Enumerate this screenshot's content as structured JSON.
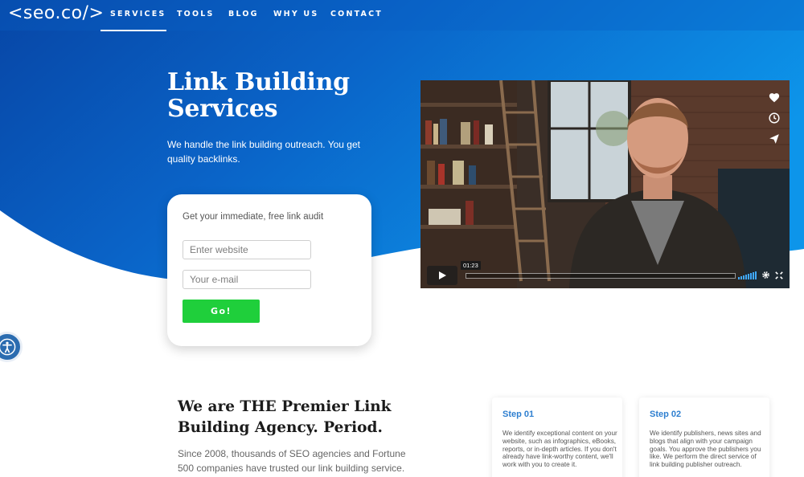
{
  "brand": {
    "logo": "<seo.co/>",
    "colors": {
      "hero_blue": "#0a64c8",
      "hero_light": "#0d8fe6",
      "accent_green": "#1fcf3b",
      "step_blue": "#2e7fd0"
    }
  },
  "nav": {
    "items": [
      {
        "label": "SERVICES",
        "active": true
      },
      {
        "label": "TOOLS",
        "active": false
      },
      {
        "label": "BLOG",
        "active": false
      },
      {
        "label": "WHY US",
        "active": false
      },
      {
        "label": "CONTACT",
        "active": false
      }
    ]
  },
  "hero": {
    "title_line1": "Link Building",
    "title_line2": "Services",
    "subtitle": "We handle the link building outreach. You get quality backlinks."
  },
  "audit": {
    "title": "Get your immediate, free link audit",
    "website_placeholder": "Enter website",
    "email_placeholder": "Your e-mail",
    "button": "Go!"
  },
  "video": {
    "time": "01:23",
    "side_icons": [
      "heart-icon",
      "clock-icon",
      "send-icon"
    ]
  },
  "premier": {
    "title": "We are THE Premier Link Building Agency. Period.",
    "subtitle": "Since 2008, thousands of SEO agencies and Fortune 500 companies have trusted our link building service."
  },
  "steps": [
    {
      "title": "Step 01",
      "text": "We identify exceptional content on your website, such as infographics, eBooks, reports, or in-depth articles. If you don't already have link-worthy content, we'll work with you to create it."
    },
    {
      "title": "Step 02",
      "text": "We identify publishers, news sites and blogs that align with your campaign goals. You approve the publishers you like. We perform the direct service of link building publisher outreach."
    }
  ]
}
